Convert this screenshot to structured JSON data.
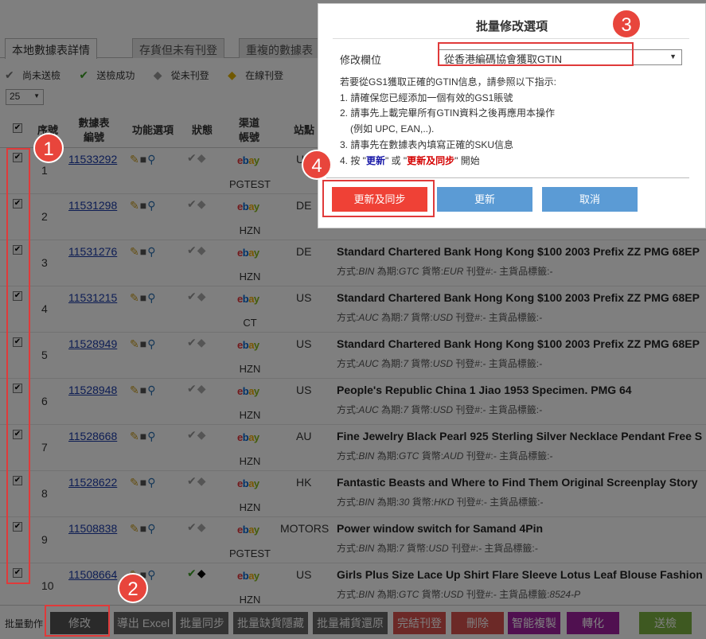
{
  "tabs": [
    "本地數據表詳情",
    "存貨但未有刊登",
    "重複的數據表"
  ],
  "legend": [
    {
      "icon": "check-icon",
      "label": "尚未送檢"
    },
    {
      "icon": "check-icon",
      "label": "送檢成功"
    },
    {
      "icon": "tag-icon",
      "label": "從未刊登"
    },
    {
      "icon": "tag-icon",
      "label": "在線刊登"
    }
  ],
  "page_size": "25",
  "headers": {
    "seq": "序號",
    "id_line1": "數據表",
    "id_line2": "編號",
    "actions": "功能選項",
    "status": "狀態",
    "channel_line1": "渠道",
    "channel_line2": "帳號",
    "site": "站點"
  },
  "rows": [
    {
      "seq": "1",
      "id": "11533292",
      "channel": "PGTEST",
      "site": "U",
      "title": "",
      "info": {
        "method": "",
        "period": "",
        "currency": "",
        "listing": "",
        "main_label": ""
      }
    },
    {
      "seq": "2",
      "id": "11531298",
      "channel": "HZN",
      "site": "DE",
      "title": "",
      "info": {
        "method": "",
        "period": "",
        "currency": "",
        "listing": "",
        "main_label": ""
      }
    },
    {
      "seq": "3",
      "id": "11531276",
      "channel": "HZN",
      "site": "DE",
      "title": "Standard Chartered Bank Hong Kong $100 2003 Prefix ZZ PMG 68EP",
      "info": {
        "method": "BIN",
        "period": "GTC",
        "currency": "EUR",
        "listing": "-",
        "main_label": "-"
      }
    },
    {
      "seq": "4",
      "id": "11531215",
      "channel": "CT",
      "site": "US",
      "title": "Standard Chartered Bank Hong Kong $100 2003 Prefix ZZ PMG 68EP",
      "info": {
        "method": "AUC",
        "period": "7",
        "currency": "USD",
        "listing": "-",
        "main_label": "-"
      }
    },
    {
      "seq": "5",
      "id": "11528949",
      "channel": "HZN",
      "site": "US",
      "title": "Standard Chartered Bank Hong Kong $100 2003 Prefix ZZ PMG 68EP",
      "info": {
        "method": "AUC",
        "period": "7",
        "currency": "USD",
        "listing": "-",
        "main_label": "-"
      }
    },
    {
      "seq": "6",
      "id": "11528948",
      "channel": "HZN",
      "site": "US",
      "title": "People's Republic China 1 Jiao 1953 Specimen. PMG 64",
      "info": {
        "method": "AUC",
        "period": "7",
        "currency": "USD",
        "listing": "-",
        "main_label": "-"
      }
    },
    {
      "seq": "7",
      "id": "11528668",
      "channel": "HZN",
      "site": "AU",
      "title": "Fine Jewelry Black Pearl 925 Sterling Silver Necklace Pendant Free S",
      "info": {
        "method": "BIN",
        "period": "GTC",
        "currency": "AUD",
        "listing": "-",
        "main_label": "-"
      }
    },
    {
      "seq": "8",
      "id": "11528622",
      "channel": "HZN",
      "site": "HK",
      "title": "Fantastic Beasts and Where to Find Them Original Screenplay Story",
      "info": {
        "method": "BIN",
        "period": "30",
        "currency": "HKD",
        "listing": "-",
        "main_label": "-"
      }
    },
    {
      "seq": "9",
      "id": "11508838",
      "channel": "PGTEST",
      "site": "MOTORS",
      "title": "Power window switch for Samand 4Pin",
      "info": {
        "method": "BIN",
        "period": "7",
        "currency": "USD",
        "listing": "-",
        "main_label": "-"
      }
    },
    {
      "seq": "10",
      "id": "11508664",
      "channel": "HZN",
      "site": "US",
      "title": "Girls Plus Size Lace Up Shirt Flare Sleeve Lotus Leaf Blouse Fashion",
      "info": {
        "method": "BIN",
        "period": "GTC",
        "currency": "USD",
        "listing": "-",
        "main_label": "8524-P"
      }
    }
  ],
  "info_labels": {
    "method": "方式:",
    "period": "為期:",
    "currency": "貨幣:",
    "listing": "刊登#:",
    "main_label": "主貨品標籤:"
  },
  "bottom": {
    "label": "批量動作",
    "buttons": [
      "修改",
      "導出 Excel",
      "批量同步",
      "批量缺貨隱藏",
      "批量補貨還原",
      "完結刊登",
      "刪除",
      "智能複製",
      "轉化",
      "送檢"
    ],
    "colors": [
      "#555555",
      "#666666",
      "#666666",
      "#666666",
      "#666666",
      "#d9534f",
      "#d9534f",
      "#a020a0",
      "#a020a0",
      "#7cb342"
    ]
  },
  "modal": {
    "title": "批量修改選項",
    "field_label": "修改欄位",
    "field_value": "從香港編碼協會獲取GTIN",
    "instructions": {
      "intro": "若要從GS1獲取正確的GTIN信息，請參照以下指示:",
      "step1": "1. 請確保您已經添加一個有效的GS1賬號",
      "step2a": "2. 請事先上載完畢所有GTIN資料之後再應用本操作",
      "step2b": "(例如 UPC, EAN,..).",
      "step3": "3. 請事先在數據表內填寫正確的SKU信息",
      "step4_prefix": "4. 按 \"",
      "step4_update": "更新",
      "step4_mid": "\" 或 \"",
      "step4_sync": "更新及同步",
      "step4_suffix": "\" 開始"
    },
    "buttons": {
      "update_sync": "更新及同步",
      "update": "更新",
      "cancel": "取消"
    },
    "colors": {
      "update_sync": "#ef4136",
      "update": "#5b9bd5",
      "cancel": "#5b9bd5",
      "update_text": "#1a1aa8",
      "sync_text": "#d40000"
    }
  },
  "annotations": [
    "1",
    "2",
    "3",
    "4"
  ]
}
